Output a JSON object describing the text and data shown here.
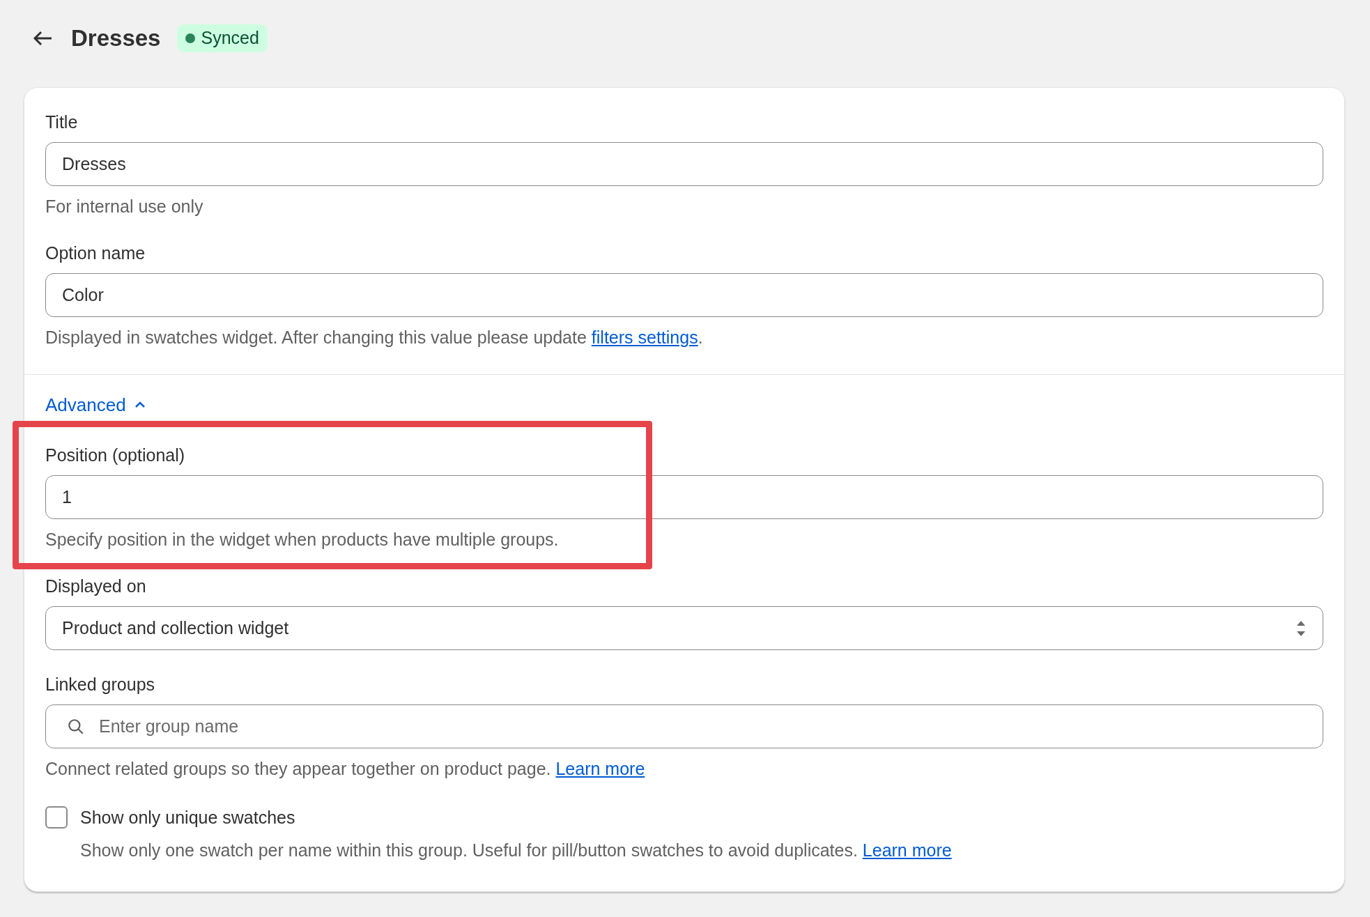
{
  "header": {
    "title": "Dresses",
    "badge": "Synced"
  },
  "main_fields": [
    {
      "kind": "text",
      "label": "Title",
      "value": "Dresses",
      "help": "For internal use only"
    },
    {
      "kind": "text",
      "label": "Option name",
      "value": "Color",
      "help": "Displayed in swatches widget. After changing this value please update ",
      "link": "filters settings",
      "after": "."
    }
  ],
  "advanced": {
    "label": "Advanced",
    "expanded": true
  },
  "advanced_fields": [
    {
      "kind": "text",
      "label": "Position (optional)",
      "value": "1",
      "help": "Specify position in the widget when products have multiple groups."
    },
    {
      "kind": "select",
      "label": "Displayed on",
      "value": "Product and collection widget"
    },
    {
      "kind": "search",
      "label": "Linked groups",
      "placeholder": "Enter group name",
      "help": "Connect related groups so they appear together on product page. ",
      "link": "Learn more"
    }
  ],
  "checkbox": {
    "label": "Show only unique swatches",
    "checked": false,
    "help": "Show only one swatch per name within this group. Useful for pill/button swatches to avoid duplicates. ",
    "link": "Learn more"
  }
}
